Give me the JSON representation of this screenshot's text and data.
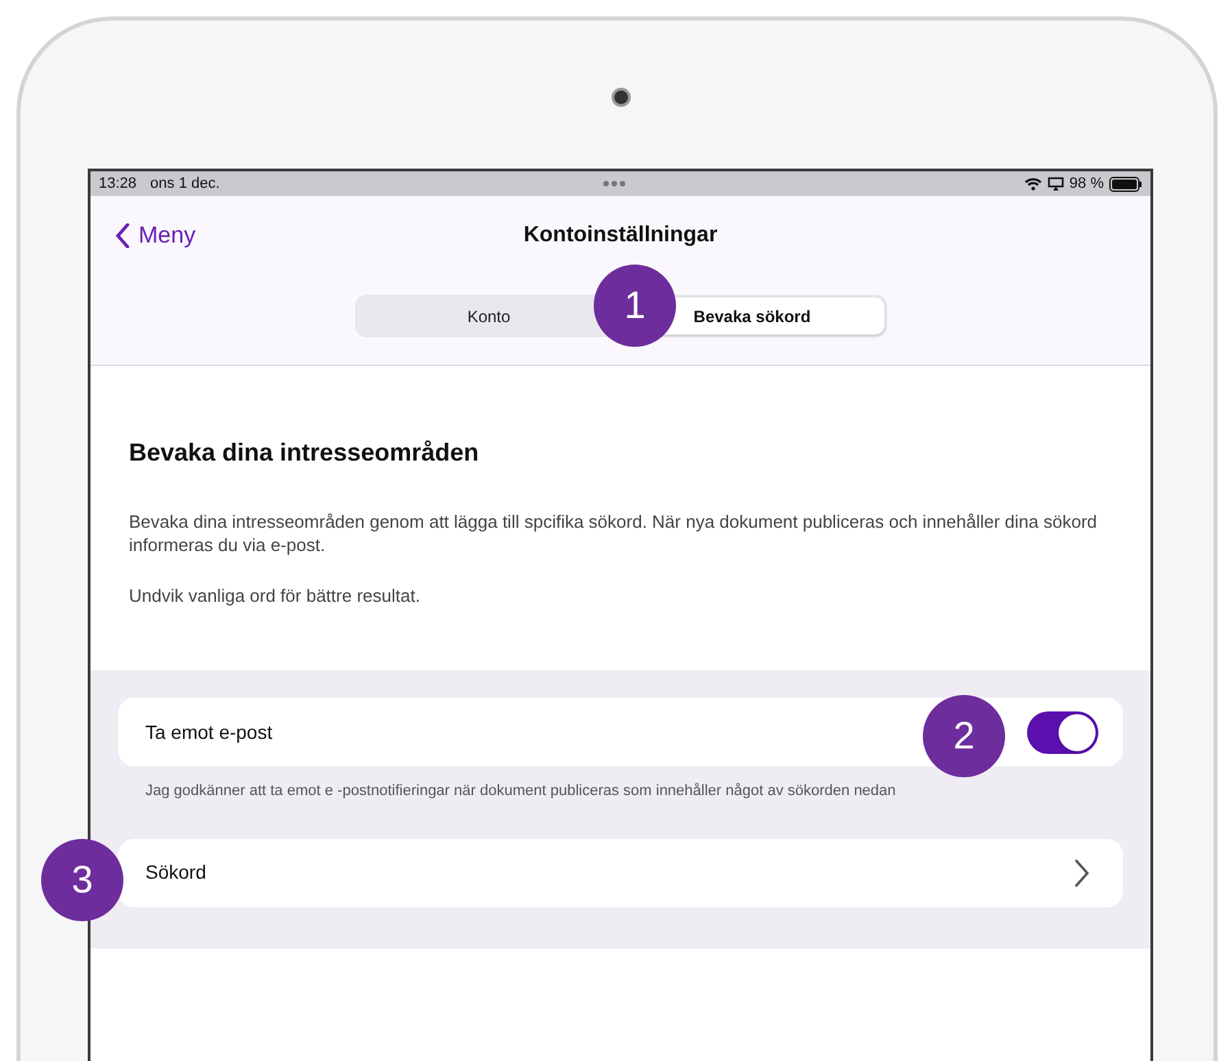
{
  "status_bar": {
    "time": "13:28",
    "date": "ons 1 dec.",
    "battery": "98 %"
  },
  "nav": {
    "back": "Meny",
    "title": "Kontoinställningar"
  },
  "segments": [
    {
      "label": "Konto",
      "selected": false
    },
    {
      "label": "Bevaka sökord",
      "selected": true
    }
  ],
  "heading": "Bevaka dina intresseområden",
  "paragraphs": [
    "Bevaka dina intresseområden genom att lägga till spcifika sökord. När nya dokument publiceras och innehåller dina sökord informeras du via e-post.",
    "Undvik vanliga ord för bättre resultat."
  ],
  "email_toggle": {
    "label": "Ta emot e-post",
    "on": true
  },
  "toggle_note": "Jag godkänner att ta emot e -postnotifieringar när dokument publiceras som innehåller något av sökorden nedan",
  "keyword_row": {
    "label": "Sökord"
  },
  "callouts": [
    "1",
    "2",
    "3"
  ]
}
